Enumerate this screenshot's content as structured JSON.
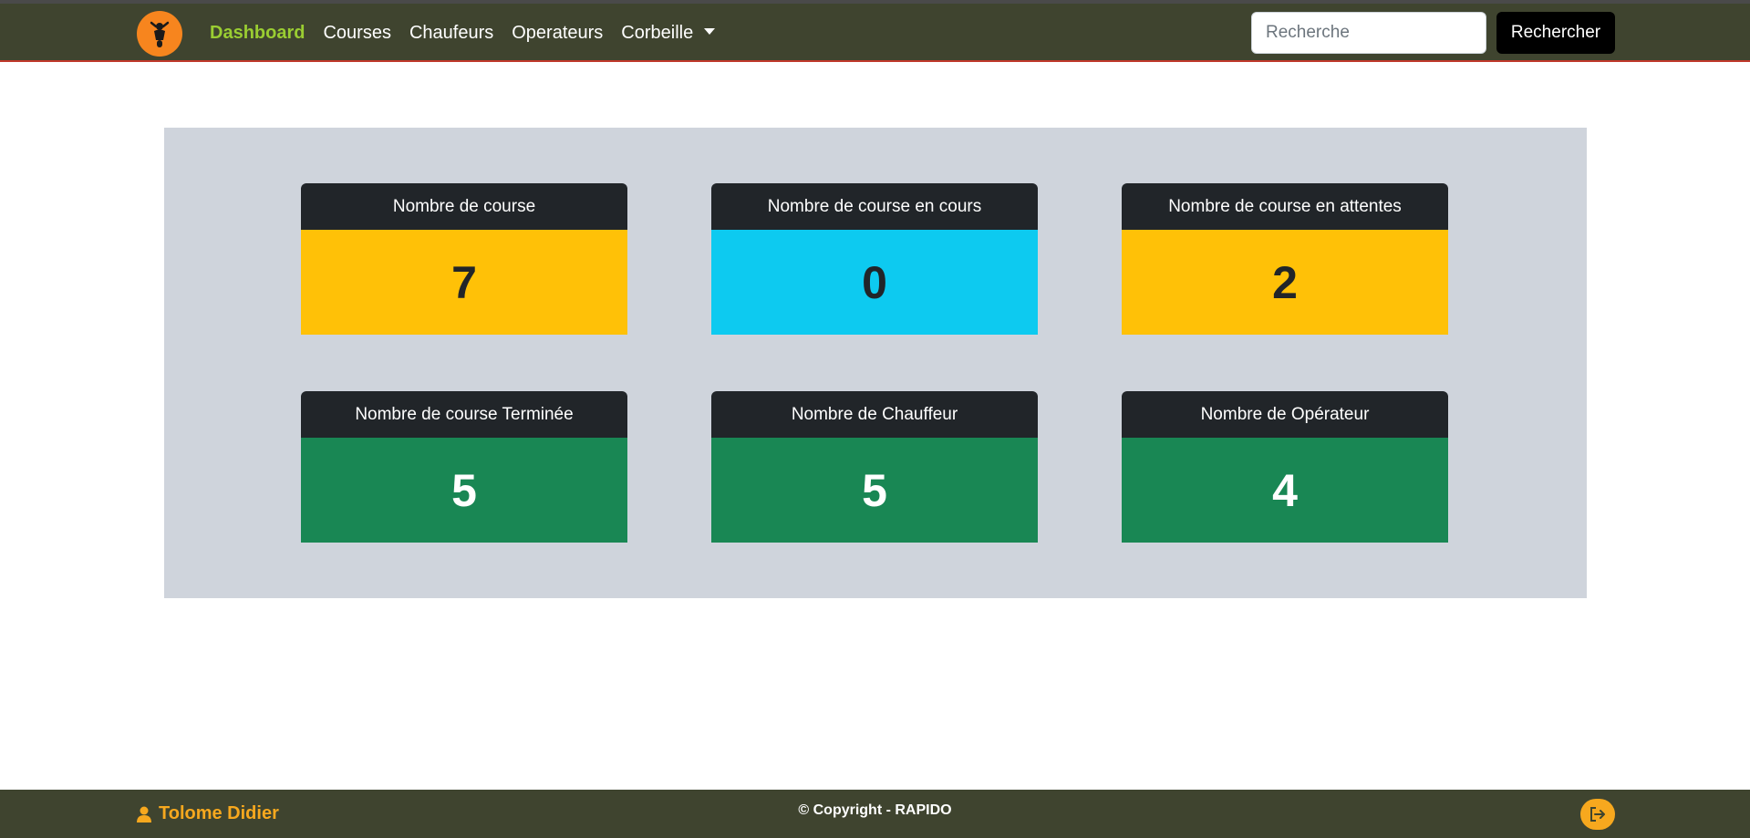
{
  "navbar": {
    "logo_icon": "scooter-rider-icon",
    "links": [
      "Dashboard",
      "Courses",
      "Chaufeurs",
      "Operateurs",
      "Corbeille"
    ],
    "active_link": "Dashboard",
    "search_placeholder": "Recherche",
    "search_value": "",
    "search_button": "Rechercher"
  },
  "stats": [
    {
      "title": "Nombre de course",
      "value": "7",
      "color": "#ffc107"
    },
    {
      "title": "Nombre de course en cours",
      "value": "0",
      "color": "#0dcaf0"
    },
    {
      "title": "Nombre de course en attentes",
      "value": "2",
      "color": "#ffc107"
    },
    {
      "title": "Nombre de course Terminée",
      "value": "5",
      "color": "#198754"
    },
    {
      "title": "Nombre de Chauffeur",
      "value": "5",
      "color": "#198754"
    },
    {
      "title": "Nombre de Opérateur",
      "value": "4",
      "color": "#198754"
    }
  ],
  "footer": {
    "user_icon": "user-icon",
    "user_name": "Tolome Didier",
    "copyright": "© Copyright - RAPIDO",
    "logout_icon": "logout-icon"
  },
  "colors": {
    "navbar_bg": "#3f442f",
    "active_link": "#9acd32",
    "accent_orange": "#f7851e",
    "panel_bg": "#cfd4dc"
  }
}
